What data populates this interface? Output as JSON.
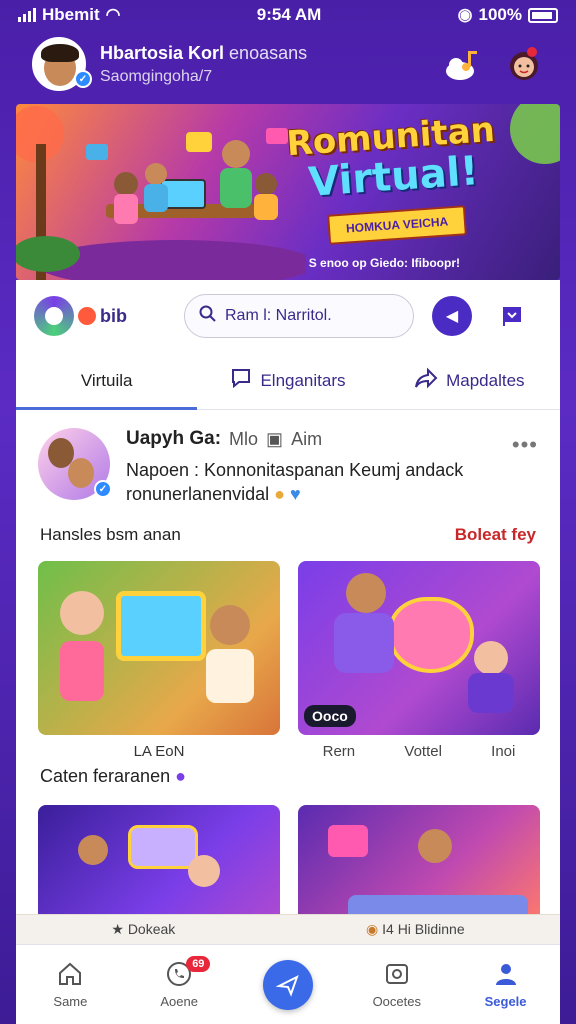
{
  "status_bar": {
    "carrier": "Hbemit",
    "time": "9:54 AM",
    "battery": "100%"
  },
  "profile": {
    "name": "Hbartosia Korl",
    "name_suffix": "enoasans",
    "subtitle": "Saomgingoha/7",
    "icons": [
      "music-cloud-icon",
      "girl-avatar-icon"
    ]
  },
  "banner": {
    "title_line1": "Romunitan",
    "title_line2": "Virtual!",
    "ribbon": "HOMKUA VEICHA",
    "caption": "S enoo op Giedo: Ifiboopr!"
  },
  "toolbar": {
    "logo_text": "bib",
    "search_placeholder": "Ram l: Narritol."
  },
  "tabs": [
    {
      "label": "Virtuila",
      "icon": "",
      "active": true
    },
    {
      "label": "Elnganitars",
      "icon": "chat-icon",
      "active": false
    },
    {
      "label": "Mapdaltes",
      "icon": "share-icon",
      "active": false
    }
  ],
  "post": {
    "author": "Uapyh Ga:",
    "meta1": "Mlo",
    "meta2": "Aim",
    "body_line1": "Napoen : Konnonitaspanan Keumj andack",
    "body_line2": "ronunerlanenvidal"
  },
  "section1": {
    "title": "Hansles bsm anan",
    "link": "Boleat fey"
  },
  "tiles_row1": [
    {
      "badge": ""
    },
    {
      "badge": "Ooco"
    }
  ],
  "captions_row1": {
    "left": "LA EoN",
    "right": [
      "Rern",
      "Vottel",
      "Inoi"
    ]
  },
  "section2": {
    "title": "Caten feraranen"
  },
  "strip": {
    "left": "Dokeak",
    "right": "I4 Hi Blidinne"
  },
  "bottom_nav": [
    {
      "label": "Same",
      "icon": "home-icon",
      "active": false,
      "badge": ""
    },
    {
      "label": "Aoene",
      "icon": "phone-icon",
      "active": false,
      "badge": "69"
    },
    {
      "label": "",
      "icon": "plane-icon",
      "active": false,
      "badge": ""
    },
    {
      "label": "Oocetes",
      "icon": "photo-icon",
      "active": false,
      "badge": ""
    },
    {
      "label": "Segele",
      "icon": "person-icon",
      "active": true,
      "badge": ""
    }
  ]
}
